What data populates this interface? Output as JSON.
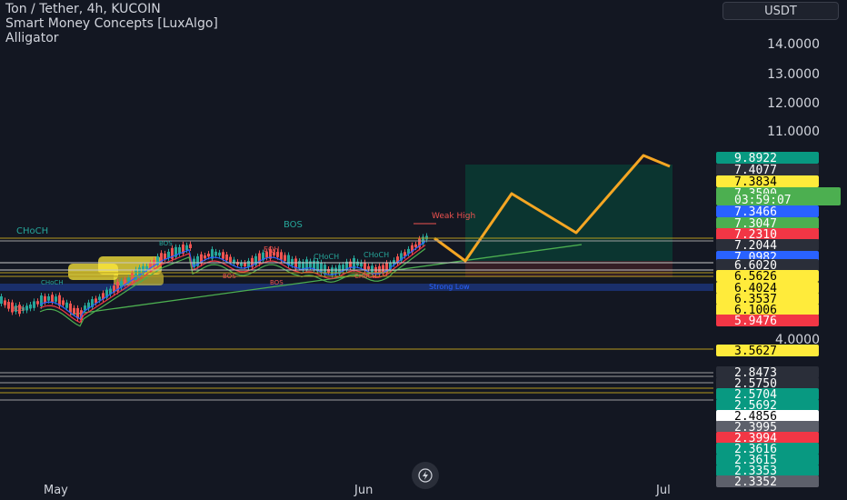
{
  "header": {
    "symbol": "Ton / Tether, 4h, KUCOIN",
    "indicator1": "Smart Money Concepts [LuxAlgo]",
    "indicator2": "Alligator"
  },
  "currency_button": "USDT",
  "x_axis": {
    "labels": [
      "May",
      "Jun",
      "Jul"
    ]
  },
  "chart_data": {
    "type": "line",
    "title": "Ton / Tether, 4h, KUCOIN",
    "y_axis_labels": [
      "14.0000",
      "13.0000",
      "12.0000",
      "11.0000",
      "4.0000"
    ],
    "y_axis_values": [
      14,
      13,
      12,
      11,
      4
    ],
    "price_tags": [
      {
        "text": "9.8922",
        "bg": "#089981",
        "fg": "#ffffff"
      },
      {
        "text": "7.4077",
        "bg": "#2a2e39",
        "fg": "#ffffff"
      },
      {
        "text": "7.3834",
        "bg": "#ffeb3b",
        "fg": "#000000"
      },
      {
        "text": "7.3500",
        "bg": "#4caf50",
        "fg": "#ffffff"
      },
      {
        "text": "03:59:07",
        "bg": "#4caf50",
        "fg": "#ffffff"
      },
      {
        "text": "7.3466",
        "bg": "#2962ff",
        "fg": "#ffffff"
      },
      {
        "text": "7.3047",
        "bg": "#4caf50",
        "fg": "#ffffff"
      },
      {
        "text": "7.2310",
        "bg": "#f23645",
        "fg": "#ffffff"
      },
      {
        "text": "7.2044",
        "bg": "#2a2e39",
        "fg": "#ffffff"
      },
      {
        "text": "7.0982",
        "bg": "#2962ff",
        "fg": "#ffffff"
      },
      {
        "text": "6.6020",
        "bg": "#2a2e39",
        "fg": "#ffffff"
      },
      {
        "text": "6.5626",
        "bg": "#ffeb3b",
        "fg": "#000000"
      },
      {
        "text": "6.4024",
        "bg": "#ffeb3b",
        "fg": "#000000"
      },
      {
        "text": "6.3537",
        "bg": "#ffeb3b",
        "fg": "#000000"
      },
      {
        "text": "6.1006",
        "bg": "#ffeb3b",
        "fg": "#000000"
      },
      {
        "text": "5.9476",
        "bg": "#f23645",
        "fg": "#ffffff"
      },
      {
        "text": "3.5627",
        "bg": "#ffeb3b",
        "fg": "#000000"
      },
      {
        "text": "2.8473",
        "bg": "#2a2e39",
        "fg": "#ffffff"
      },
      {
        "text": "2.5750",
        "bg": "#2a2e39",
        "fg": "#ffffff"
      },
      {
        "text": "2.5704",
        "bg": "#089981",
        "fg": "#ffffff"
      },
      {
        "text": "2.5692",
        "bg": "#089981",
        "fg": "#ffffff"
      },
      {
        "text": "2.4856",
        "bg": "#ffffff",
        "fg": "#000000"
      },
      {
        "text": "2.3995",
        "bg": "#5d606b",
        "fg": "#ffffff"
      },
      {
        "text": "2.3994",
        "bg": "#f23645",
        "fg": "#ffffff"
      },
      {
        "text": "2.3616",
        "bg": "#089981",
        "fg": "#ffffff"
      },
      {
        "text": "2.3615",
        "bg": "#089981",
        "fg": "#ffffff"
      },
      {
        "text": "2.3353",
        "bg": "#089981",
        "fg": "#ffffff"
      },
      {
        "text": "2.3352",
        "bg": "#5d606b",
        "fg": "#ffffff"
      }
    ],
    "annotations": [
      "CHoCH",
      "BOS",
      "Weak High",
      "EQH",
      "CHoCH",
      "CHoCH",
      "BOS",
      "BOS",
      "CHoCH",
      "Strong Low",
      "CHoCH",
      "BOS",
      "BOS"
    ],
    "colors": {
      "background": "#131722",
      "projection": "#f5a623",
      "target_zone": "#0b3b32",
      "bull": "#26a69a",
      "bear": "#ef5350",
      "level_line": "#b59a1e"
    }
  }
}
